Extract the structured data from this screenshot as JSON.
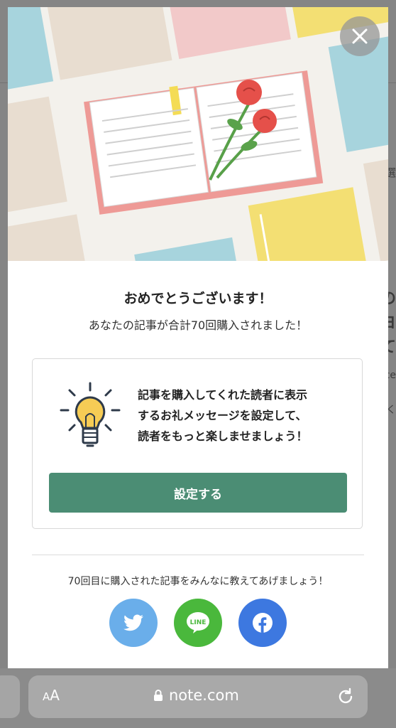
{
  "modal": {
    "title": "おめでとうございます！",
    "subtitle": "あなたの記事が合計70回購入されました！",
    "card": {
      "lines": [
        "記事を購入してくれた読者に表示",
        "するお礼メッセージを設定して、",
        "読者をもっと楽しませましょう！"
      ],
      "button_label": "設定する"
    },
    "share": {
      "text": "70回目に購入された記事をみんなに教えてあげましょう！",
      "buttons": [
        {
          "icon": "twitter-icon",
          "color": "#6aaeea"
        },
        {
          "icon": "line-icon",
          "label": "LINE",
          "color": "#4ab83c"
        },
        {
          "icon": "facebook-icon",
          "color": "#3d78e0"
        }
      ]
    },
    "close_icon": "close-icon",
    "accent_color": "#4b8d74"
  },
  "browser": {
    "text_size_small": "A",
    "text_size_big": "A",
    "url": "note.com",
    "lock_icon": "lock-icon",
    "reload_icon": "reload-icon"
  },
  "background_page": {
    "fragments": [
      "選",
      "の",
      "ヨ",
      "て",
      "ce",
      "らく"
    ]
  }
}
